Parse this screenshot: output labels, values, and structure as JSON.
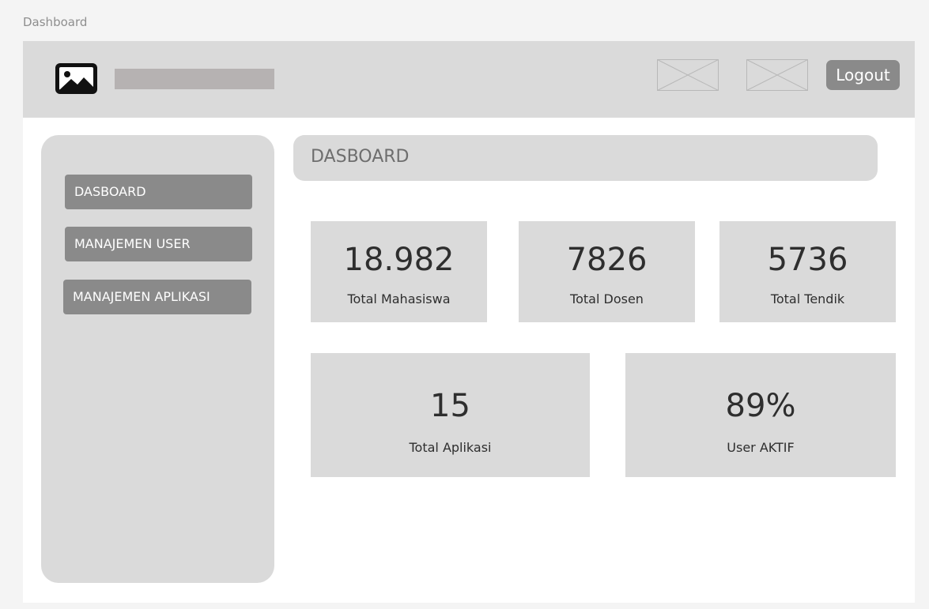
{
  "frame_title": "Dashboard",
  "header": {
    "logo_icon": "image-icon",
    "placeholder_icons": [
      "image-placeholder",
      "image-placeholder"
    ],
    "logout_label": "Logout"
  },
  "sidebar": {
    "items": [
      {
        "label": "DASBOARD"
      },
      {
        "label": "MANAJEMEN USER"
      },
      {
        "label": "MANAJEMEN APLIKASI"
      }
    ]
  },
  "main": {
    "title": "DASBOARD",
    "stats": [
      {
        "value": "18.982",
        "label": "Total Mahasiswa"
      },
      {
        "value": "7826",
        "label": "Total Dosen"
      },
      {
        "value": "5736",
        "label": "Total Tendik"
      },
      {
        "value": "15",
        "label": "Total Aplikasi"
      },
      {
        "value": "89%",
        "label": "User AKTIF"
      }
    ]
  },
  "colors": {
    "panel": "#dadada",
    "button": "#8a8a8a",
    "button_text": "#ffffff",
    "text": "#2e2e2e"
  }
}
